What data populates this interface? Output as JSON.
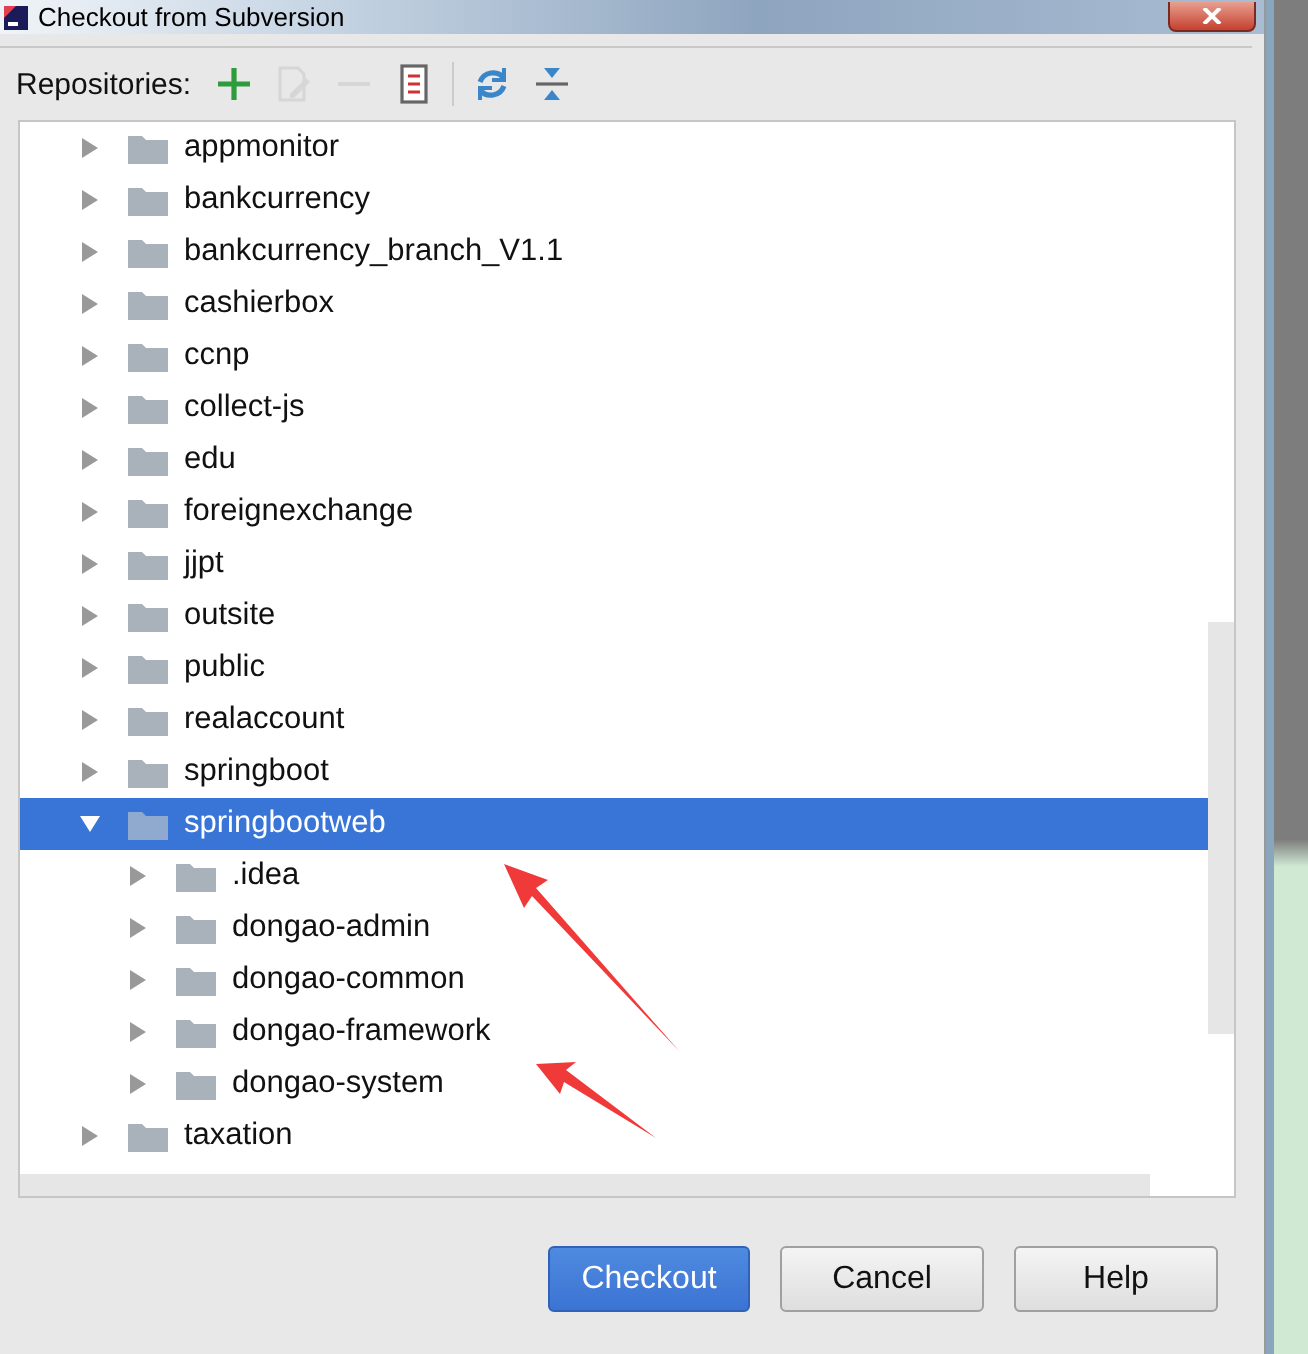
{
  "window": {
    "title": "Checkout from Subversion"
  },
  "toolbar": {
    "label": "Repositories:",
    "tools": [
      {
        "kind": "add",
        "disabled": false
      },
      {
        "kind": "edit",
        "disabled": true
      },
      {
        "kind": "remove",
        "disabled": true
      },
      {
        "kind": "browse",
        "disabled": false
      },
      {
        "kind": "separator"
      },
      {
        "kind": "refresh",
        "disabled": false
      },
      {
        "kind": "collapse",
        "disabled": false
      }
    ]
  },
  "tree": [
    {
      "label": "appmonitor",
      "expanded": false,
      "selected": false
    },
    {
      "label": "bankcurrency",
      "expanded": false,
      "selected": false
    },
    {
      "label": "bankcurrency_branch_V1.1",
      "expanded": false,
      "selected": false
    },
    {
      "label": "cashierbox",
      "expanded": false,
      "selected": false
    },
    {
      "label": "ccnp",
      "expanded": false,
      "selected": false
    },
    {
      "label": "collect-js",
      "expanded": false,
      "selected": false
    },
    {
      "label": "edu",
      "expanded": false,
      "selected": false
    },
    {
      "label": "foreignexchange",
      "expanded": false,
      "selected": false
    },
    {
      "label": "jjpt",
      "expanded": false,
      "selected": false
    },
    {
      "label": "outsite",
      "expanded": false,
      "selected": false
    },
    {
      "label": "public",
      "expanded": false,
      "selected": false
    },
    {
      "label": "realaccount",
      "expanded": false,
      "selected": false
    },
    {
      "label": "springboot",
      "expanded": false,
      "selected": false
    },
    {
      "label": "springbootweb",
      "expanded": true,
      "selected": true,
      "children": [
        {
          "label": ".idea",
          "expanded": false,
          "selected": false
        },
        {
          "label": "dongao-admin",
          "expanded": false,
          "selected": false
        },
        {
          "label": "dongao-common",
          "expanded": false,
          "selected": false
        },
        {
          "label": "dongao-framework",
          "expanded": false,
          "selected": false
        },
        {
          "label": "dongao-system",
          "expanded": false,
          "selected": false
        }
      ]
    },
    {
      "label": "taxation",
      "expanded": false,
      "selected": false
    }
  ],
  "buttons": [
    {
      "label": "Checkout",
      "default": true
    },
    {
      "label": "Cancel",
      "default": false
    },
    {
      "label": "Help",
      "default": false
    }
  ]
}
